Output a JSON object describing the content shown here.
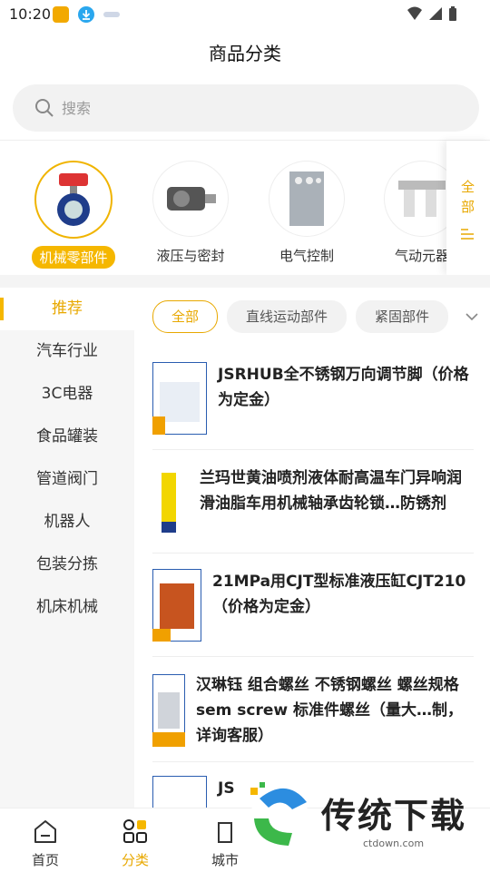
{
  "status_bar": {
    "time": "10:20"
  },
  "header": {
    "title": "商品分类"
  },
  "search": {
    "placeholder": "搜索"
  },
  "categories": [
    {
      "label": "机械零部件",
      "active": true
    },
    {
      "label": "液压与密封",
      "active": false
    },
    {
      "label": "电气控制",
      "active": false
    },
    {
      "label": "气动元器",
      "active": false
    }
  ],
  "all_button": {
    "label": "全部"
  },
  "sidebar": {
    "items": [
      {
        "label": "推荐",
        "active": true
      },
      {
        "label": "汽车行业",
        "active": false
      },
      {
        "label": "3C电器",
        "active": false
      },
      {
        "label": "食品罐装",
        "active": false
      },
      {
        "label": "管道阀门",
        "active": false
      },
      {
        "label": "机器人",
        "active": false
      },
      {
        "label": "包装分拣",
        "active": false
      },
      {
        "label": "机床机械",
        "active": false
      }
    ]
  },
  "chips": [
    {
      "label": "全部",
      "active": true
    },
    {
      "label": "直线运动部件",
      "active": false
    },
    {
      "label": "紧固部件",
      "active": false
    }
  ],
  "products": [
    {
      "title": "JSRHUB全不锈钢万向调节脚（价格为定金）"
    },
    {
      "title": "兰玛世黄油喷剂液体耐高温车门异响润滑油脂车用机械轴承齿轮锁…防锈剂"
    },
    {
      "title": "21MPa用CJT型标准液压缸CJT210（价格为定金）"
    },
    {
      "title": "汉琳钰 组合螺丝 不锈钢螺丝 螺丝规格 sem screw 标准件螺丝（量大…制，详询客服）"
    },
    {
      "title": "JS"
    }
  ],
  "tabbar": {
    "items": [
      {
        "label": "首页",
        "active": false
      },
      {
        "label": "分类",
        "active": true
      },
      {
        "label": "城市",
        "active": false
      }
    ]
  },
  "watermark": {
    "text": "传统下载",
    "sub": "ctdown.com"
  },
  "colors": {
    "accent": "#f5b700",
    "accent_text": "#e8a800"
  }
}
